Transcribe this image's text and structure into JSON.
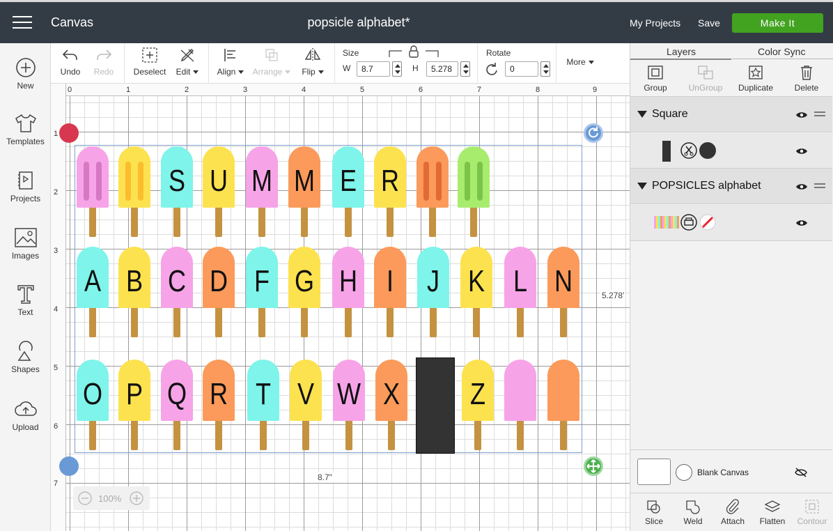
{
  "header": {
    "app_title": "Canvas",
    "doc_title": "popsicle alphabet*",
    "my_projects": "My Projects",
    "save": "Save",
    "make_it": "Make It"
  },
  "sidebar": {
    "items": [
      {
        "label": "New",
        "icon": "plus-circle-icon"
      },
      {
        "label": "Templates",
        "icon": "tshirt-icon"
      },
      {
        "label": "Projects",
        "icon": "projects-icon"
      },
      {
        "label": "Images",
        "icon": "image-icon"
      },
      {
        "label": "Text",
        "icon": "text-icon"
      },
      {
        "label": "Shapes",
        "icon": "shapes-icon"
      },
      {
        "label": "Upload",
        "icon": "upload-icon"
      }
    ]
  },
  "toolbar": {
    "undo": "Undo",
    "redo": "Redo",
    "deselect": "Deselect",
    "edit": "Edit",
    "align": "Align",
    "arrange": "Arrange",
    "flip": "Flip",
    "size_label": "Size",
    "w_label": "W",
    "w_value": "8.7",
    "h_label": "H",
    "h_value": "5.278",
    "rotate_label": "Rotate",
    "rotate_value": "0",
    "more": "More"
  },
  "canvas": {
    "ruler_x": [
      "0",
      "1",
      "2",
      "3",
      "4",
      "5",
      "6",
      "7",
      "8",
      "9"
    ],
    "ruler_y": [
      "1",
      "2",
      "3",
      "4",
      "5",
      "6",
      "7"
    ],
    "width_label": "8.7\"",
    "height_label": "5.278'",
    "zoom": "100%",
    "rows": [
      [
        "",
        "",
        "S",
        "U",
        "M",
        "M",
        "E",
        "R",
        "",
        ""
      ],
      [
        "A",
        "B",
        "C",
        "D",
        "F",
        "G",
        "H",
        "I",
        "J",
        "K",
        "L",
        "N"
      ],
      [
        "O",
        "P",
        "Q",
        "R",
        "T",
        "V",
        "W",
        "X",
        "",
        "Z",
        "",
        ""
      ]
    ],
    "colors": {
      "pink": "#f7a3e8",
      "yellow": "#fde24f",
      "cyan": "#7ef4ea",
      "orange": "#fb9a5a",
      "green": "#a8ec6e",
      "stick": "#c49240",
      "selection": "#7d9fcc"
    }
  },
  "layers_panel": {
    "tab_layers": "Layers",
    "tab_color_sync": "Color Sync",
    "group": "Group",
    "ungroup": "UnGroup",
    "duplicate": "Duplicate",
    "delete": "Delete",
    "layer1": "Square",
    "layer2": "POPSICLES alphabet",
    "blank_canvas": "Blank Canvas",
    "slice": "Slice",
    "weld": "Weld",
    "attach": "Attach",
    "flatten": "Flatten",
    "contour": "Contour"
  }
}
